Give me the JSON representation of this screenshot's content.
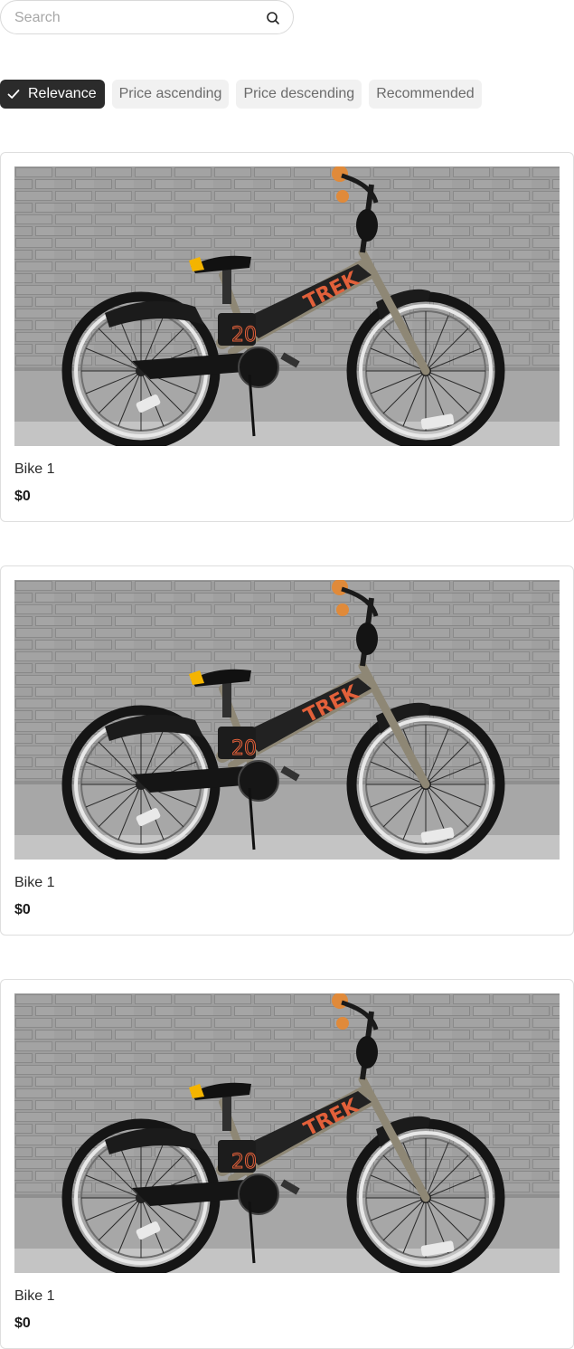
{
  "search": {
    "placeholder": "Search",
    "value": "",
    "icon": "search-icon"
  },
  "sort_options": [
    {
      "label": "Relevance",
      "selected": true,
      "icon": "check-icon"
    },
    {
      "label": "Price ascending",
      "selected": false
    },
    {
      "label": "Price descending",
      "selected": false
    },
    {
      "label": "Recommended",
      "selected": false
    }
  ],
  "products": [
    {
      "name": "Bike 1",
      "price": "$0",
      "image": "bike-photo"
    },
    {
      "name": "Bike 1",
      "price": "$0",
      "image": "bike-photo"
    },
    {
      "name": "Bike 1",
      "price": "$0",
      "image": "bike-photo"
    }
  ],
  "colors": {
    "chip_active_bg": "#2b2b2b",
    "chip_bg": "#f1f1f1",
    "frame_orange": "#e2603a"
  }
}
